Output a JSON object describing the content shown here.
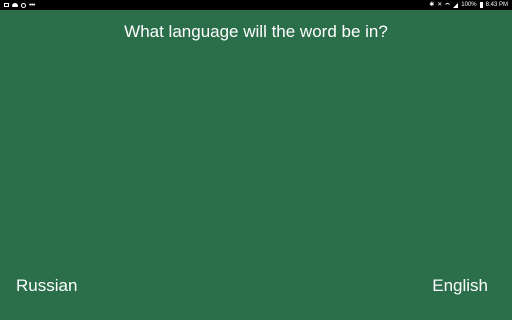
{
  "status_bar": {
    "left_icons": [
      "gallery-icon",
      "cloud-icon",
      "sync-icon",
      "more-dots-icon"
    ],
    "right_icons": [
      "bluetooth-icon",
      "mute-icon",
      "wifi-icon",
      "signal-icon"
    ],
    "battery_text": "100%",
    "time": "8:43 PM"
  },
  "quiz": {
    "question": "What language will the word be in?",
    "options": [
      "Russian",
      "English"
    ]
  },
  "colors": {
    "background": "#2a6e4a",
    "text": "#ffffff",
    "status_bar": "#000000"
  }
}
